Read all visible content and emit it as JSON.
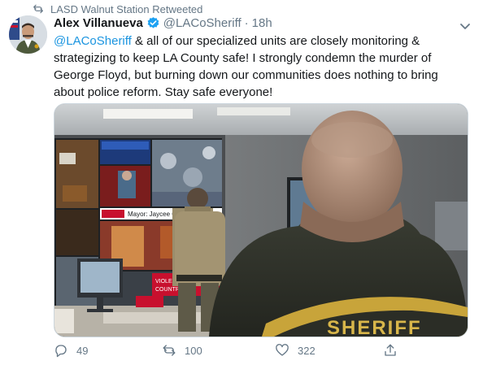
{
  "retweet_context": {
    "text": "LASD Walnut Station Retweeted",
    "icon": "retweet-icon"
  },
  "author": {
    "name": "Alex Villanueva",
    "handle": "@LACoSheriff",
    "separator": "·",
    "time": "18h",
    "verified": true
  },
  "tweet": {
    "mention": "@LACoSheriff",
    "body": " & all of our specialized units are closely monitoring & strategizing to keep LA County safe! I strongly condemn the murder of George Floyd, but burning down our communities does nothing to bring about police reform. Stay safe everyone!"
  },
  "media": {
    "screen_texts": {
      "headline": "Mayor: Jaycee Curtis Will be",
      "lower_left": "VIOLENT PRO",
      "lower_left2": "COUNTRY ON",
      "sheriff": "SHERIFF"
    }
  },
  "actions": {
    "reply": {
      "count": "49",
      "icon": "reply-icon"
    },
    "retweet": {
      "count": "100",
      "icon": "retweet-icon"
    },
    "like": {
      "count": "322",
      "icon": "heart-icon"
    },
    "share": {
      "icon": "share-icon"
    }
  },
  "colors": {
    "accent": "#1b95e0",
    "muted": "#657786",
    "verified": "#1da1f2"
  }
}
